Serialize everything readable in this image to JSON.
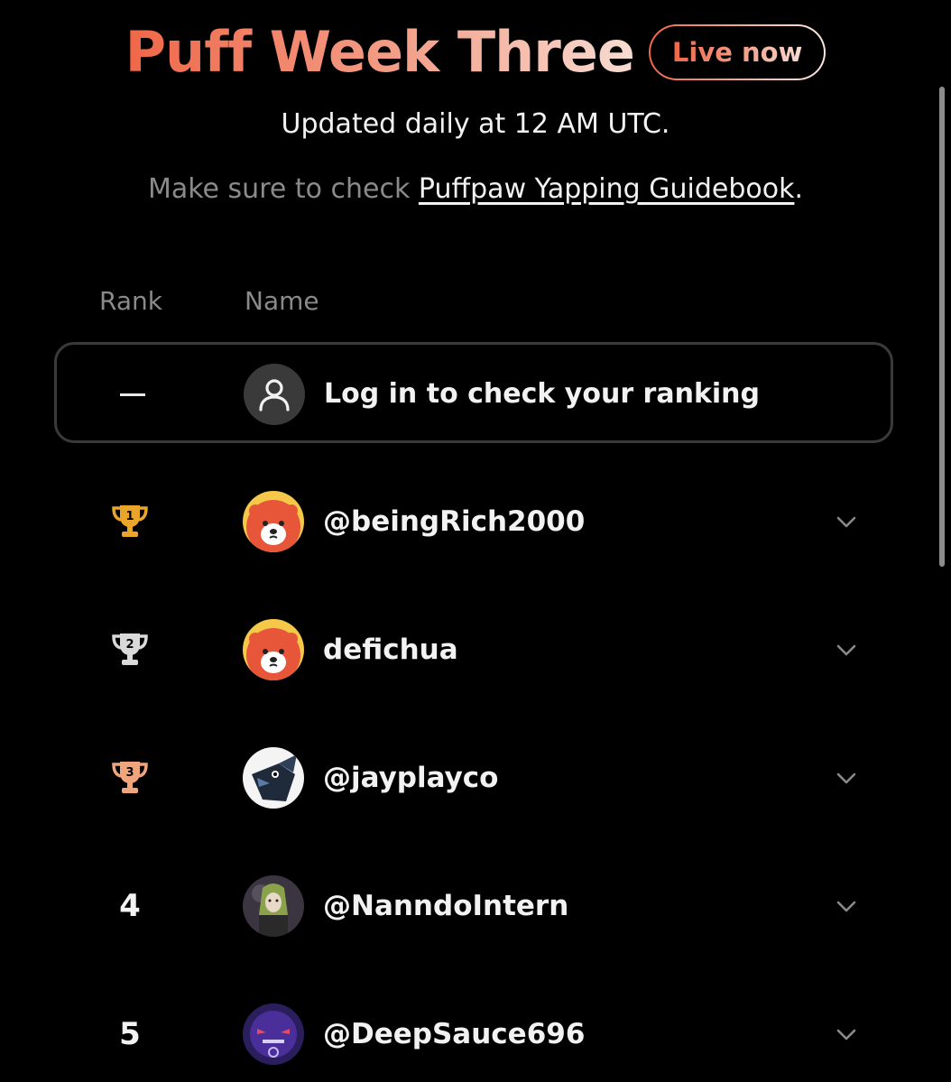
{
  "header": {
    "title": "Puff Week Three",
    "live_badge": "Live now",
    "subtitle": "Updated daily at 12 AM UTC.",
    "note_prefix": "Make sure to check ",
    "guidebook_link": "Puffpaw Yapping Guidebook",
    "note_suffix": "."
  },
  "table": {
    "columns": {
      "rank": "Rank",
      "name": "Name"
    },
    "login_row": {
      "rank_placeholder": "—",
      "text": "Log in to check your ranking",
      "icon": "user-icon"
    },
    "rows": [
      {
        "rank": "1",
        "trophy": "gold",
        "trophy_color": "#e9a62a",
        "handle": "@beingRich2000",
        "avatar": "red-panda-avatar"
      },
      {
        "rank": "2",
        "trophy": "silver",
        "trophy_color": "#d9d9d9",
        "handle": "defichua",
        "avatar": "red-panda-avatar"
      },
      {
        "rank": "3",
        "trophy": "bronze",
        "trophy_color": "#f0a57c",
        "handle": "@jayplayco",
        "avatar": "bird-avatar"
      },
      {
        "rank": "4",
        "trophy": null,
        "handle": "@NanndoIntern",
        "avatar": "green-hood-avatar"
      },
      {
        "rank": "5",
        "trophy": null,
        "handle": "@DeepSauce696",
        "avatar": "purple-ghost-avatar"
      }
    ]
  },
  "colors": {
    "background": "#000000",
    "accent_start": "#ef6748",
    "accent_end": "#f7dcd2",
    "muted_text": "#8a8a8a",
    "border": "#3a3a3a"
  }
}
